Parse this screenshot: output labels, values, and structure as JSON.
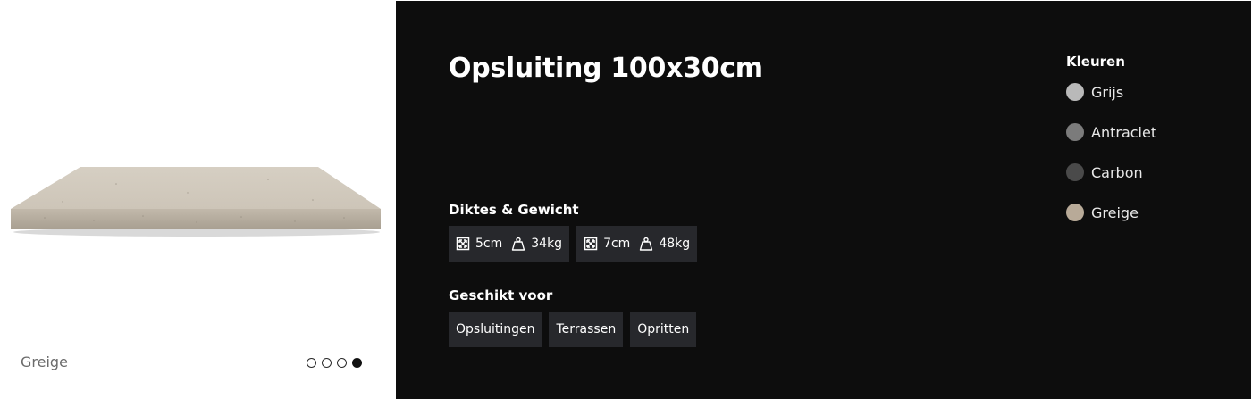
{
  "gallery": {
    "caption": "Greige",
    "active_slide": 4,
    "slide_count": 4
  },
  "product": {
    "title": "Opsluiting 100x30cm"
  },
  "thickness": {
    "label": "Diktes & Gewicht",
    "options": [
      {
        "thickness": "5cm",
        "weight": "34kg"
      },
      {
        "thickness": "7cm",
        "weight": "48kg"
      }
    ]
  },
  "suitable": {
    "label": "Geschikt voor",
    "tags": [
      "Opsluitingen",
      "Terrassen",
      "Opritten"
    ]
  },
  "colors": {
    "label": "Kleuren",
    "items": [
      {
        "name": "Grijs",
        "hex": "#b9b9b9"
      },
      {
        "name": "Antraciet",
        "hex": "#7b7b7b"
      },
      {
        "name": "Carbon",
        "hex": "#4a4a4a"
      },
      {
        "name": "Greige",
        "hex": "#b8aa98"
      }
    ]
  },
  "theme": {
    "panel_bg": "#0d0d0d",
    "chip_bg": "#27282c"
  }
}
